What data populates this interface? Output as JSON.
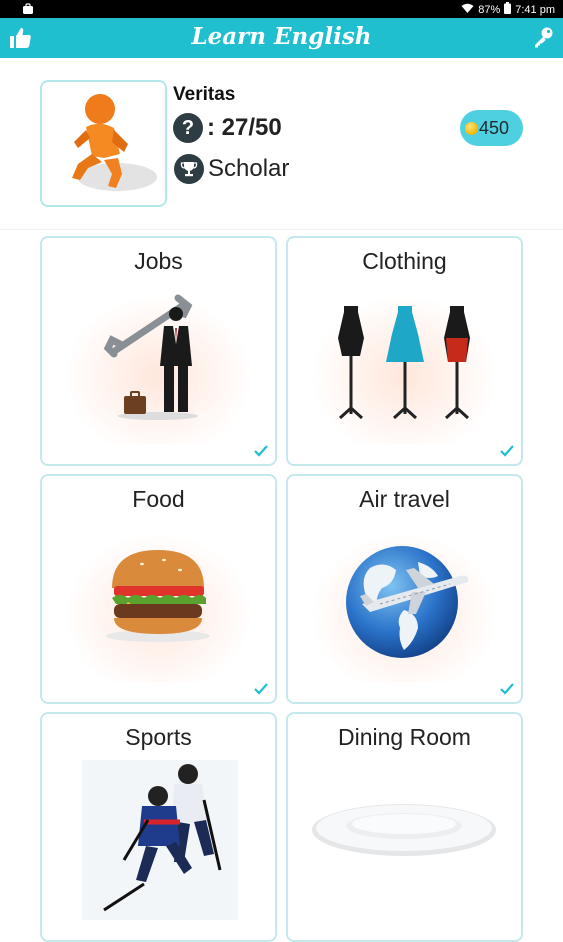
{
  "status_bar": {
    "battery": "87%",
    "time": "7:41 pm"
  },
  "app_bar": {
    "title": "Learn English",
    "left_icon": "thumbs-up-icon",
    "right_icon": "key-icon"
  },
  "profile": {
    "username": "Veritas",
    "score": ": 27/50",
    "rank": "Scholar",
    "coins": "450",
    "colors": {
      "accent": "#1fbfd0",
      "badge": "#2d3d43",
      "coin_pill": "#4fd0e0"
    }
  },
  "categories": [
    {
      "label": "Jobs",
      "completed": true
    },
    {
      "label": "Clothing",
      "completed": true
    },
    {
      "label": "Food",
      "completed": true
    },
    {
      "label": "Air travel",
      "completed": true
    },
    {
      "label": "Sports",
      "completed": false
    },
    {
      "label": "Dining Room",
      "completed": false
    }
  ]
}
